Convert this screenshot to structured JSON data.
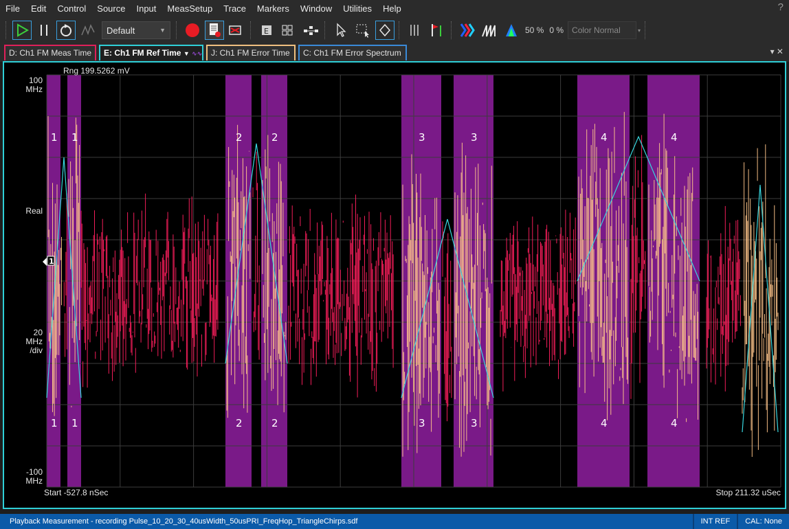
{
  "menu": [
    "File",
    "Edit",
    "Control",
    "Source",
    "Input",
    "MeasSetup",
    "Trace",
    "Markers",
    "Window",
    "Utilities",
    "Help"
  ],
  "help_symbol": "?",
  "toolbar": {
    "preset_value": "Default",
    "zoom_a": "50 %",
    "zoom_b": "0 %",
    "color_mode": "Color Normal",
    "icons": [
      "play-icon",
      "pause-icon",
      "repeat-icon",
      "averaging-icon",
      "record-icon",
      "document-icon",
      "recorder-icon",
      "e-icon",
      "grid-icon",
      "network-icon",
      "pointer-icon",
      "select-box-icon",
      "diamond-marker-icon",
      "bars-icon",
      "flag-icon",
      "spectrum-color-icon",
      "waterfall-icon",
      "spectrogram-icon"
    ]
  },
  "tabs": [
    {
      "id": "d",
      "label": "D: Ch1 FM Meas Time",
      "color": "#e0205a"
    },
    {
      "id": "e",
      "label": "E: Ch1 FM Ref Time",
      "color": "#2fd0d8"
    },
    {
      "id": "j",
      "label": "J: Ch1 FM Error Time",
      "color": "#f0c080"
    },
    {
      "id": "c",
      "label": "C: Ch1 FM Error Spectrum",
      "color": "#3a8ad8"
    }
  ],
  "tab_controls": "▾ ✕",
  "trace": {
    "range_label": "Rng 199.5262 mV",
    "y_top": "100\nMHz",
    "y_format": "Real",
    "y_scale": "20\nMHz\n/div",
    "y_bottom": "-100\nMHz",
    "marker_label": "1",
    "start_label": "Start -527.8 nSec",
    "stop_label": "Stop 211.32 uSec",
    "colors": {
      "meas": "#ff1f5e",
      "error": "#ffc58a",
      "ref": "#38d8e0",
      "pulse": "#7a1a88",
      "grid": "#3c3c3c"
    },
    "pulse_labels": [
      "1",
      "1",
      "2",
      "2",
      "3",
      "3",
      "4",
      "4"
    ]
  },
  "status": {
    "message": "Playback Measurement - recording Pulse_10_20_30_40usWidth_50usPRI_FreqHop_TriangleChirps.sdf",
    "ref": "INT REF",
    "cal": "CAL: None"
  }
}
